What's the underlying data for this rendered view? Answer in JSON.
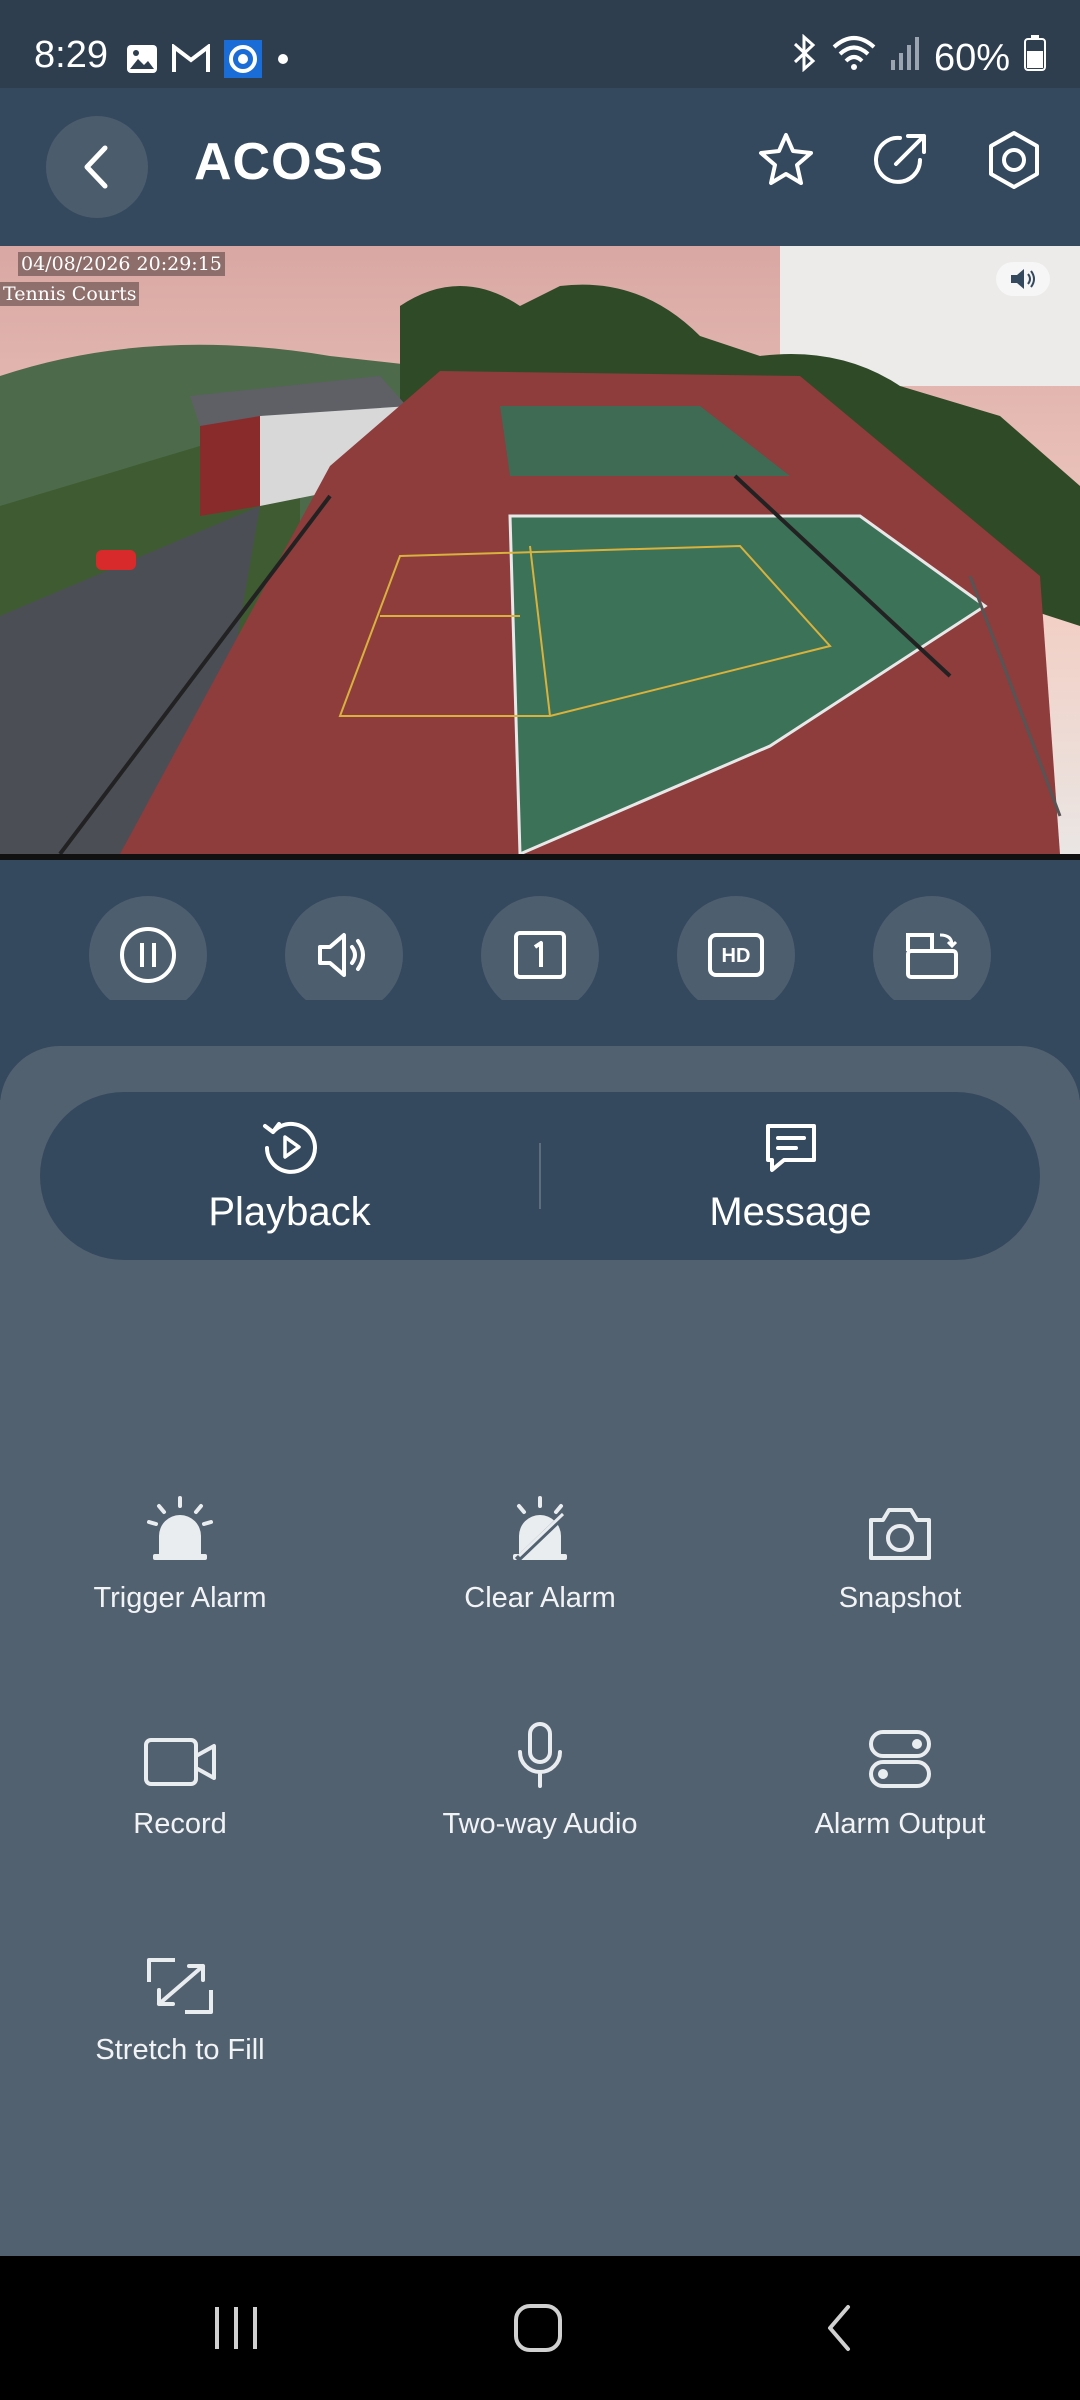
{
  "status_bar": {
    "time": "8:29",
    "battery": "60%",
    "left_icons": [
      "gallery-icon",
      "gmail-icon",
      "camera-app-icon",
      "dot-icon"
    ],
    "right_icons": [
      "bluetooth-icon",
      "wifi-icon",
      "signal-icon",
      "battery-icon"
    ]
  },
  "app_bar": {
    "title": "ACOSS",
    "actions": [
      "star-icon",
      "share-icon",
      "settings-icon"
    ]
  },
  "video": {
    "timestamp": "04/08/2026 20:29:15",
    "location": "Tennis Courts"
  },
  "controls": [
    "pause-icon",
    "speaker-icon",
    "single-view-icon",
    "hd-icon",
    "rotate-icon"
  ],
  "pill_actions": {
    "playback": "Playback",
    "message": "Message"
  },
  "actions": [
    {
      "label": "Trigger Alarm",
      "icon": "alarm-icon"
    },
    {
      "label": "Clear Alarm",
      "icon": "alarm-off-icon"
    },
    {
      "label": "Snapshot",
      "icon": "camera-icon"
    },
    {
      "label": "Record",
      "icon": "video-icon"
    },
    {
      "label": "Two-way Audio",
      "icon": "microphone-icon"
    },
    {
      "label": "Alarm Output",
      "icon": "toggle-icon"
    },
    {
      "label": "Stretch to Fill",
      "icon": "stretch-icon"
    }
  ],
  "colors": {
    "status_bar": "#2e3e4f",
    "app_bar": "#34495e",
    "panel": "#526170"
  }
}
